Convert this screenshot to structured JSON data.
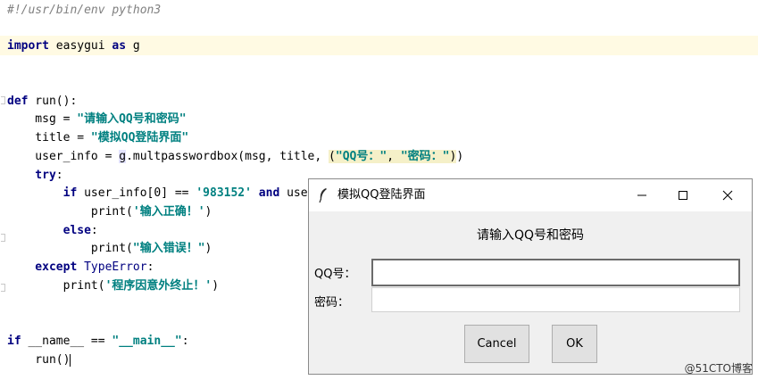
{
  "editor": {
    "shebang": "#!/usr/bin/env python3",
    "import_kw": "import",
    "import_mod": " easygui ",
    "as_kw": "as",
    "import_alias": " g",
    "def_kw": "def",
    "func_sig": " run():",
    "msg_lhs": "    msg = ",
    "msg_str": "\"请输入QQ号和密码\"",
    "title_lhs": "    title = ",
    "title_str": "\"模拟QQ登陆界面\"",
    "userinfo_lhs": "    user_info = ",
    "userinfo_g": "g",
    "userinfo_call": ".multpasswordbox(msg, title, ",
    "arg_open": "(",
    "arg_str1": "\"QQ号：\"",
    "arg_sep": ", ",
    "arg_str2": "\"密码：\"",
    "arg_close": ")",
    "call_close": ")",
    "try_kw": "    try",
    "colon": ":",
    "if_indent": "        ",
    "if_kw": "if",
    "if_cond": " user_info[0] == ",
    "if_str": "'983152'",
    "space": " ",
    "and_kw": "and",
    "if_rest": " user_i",
    "print1_pre": "            print(",
    "print1_str": "'输入正确！'",
    "print_close": ")",
    "else_kw": "        else",
    "print2_pre": "            print(",
    "print2_str": "\"输入错误！\"",
    "except_kw": "    except",
    "except_type": " TypeError",
    "print3_pre": "        print(",
    "print3_str": "'程序因意外终止！'",
    "main_if_kw": "if",
    "main_cond": " __name__ == ",
    "main_str": "\"__main__\"",
    "run_call": "    run()"
  },
  "dialog": {
    "title": "模拟QQ登陆界面",
    "message": "请输入QQ号和密码",
    "field1_label": "QQ号：",
    "field1_value": "",
    "field2_label": "密码：",
    "field2_value": "",
    "cancel_label": "Cancel",
    "ok_label": "OK"
  },
  "watermark": "@51CTO博客"
}
